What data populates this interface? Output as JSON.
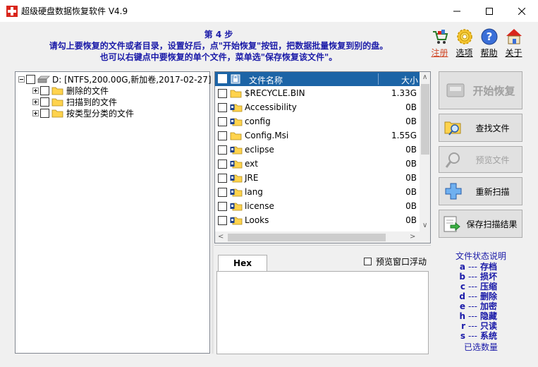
{
  "window": {
    "title": "超级硬盘数据恢复软件 V4.9"
  },
  "instructions": {
    "step": "第 4 步",
    "line1": "请勾上要恢复的文件或者目录，设置好后，点\"开始恢复\"按钮，把数据批量恢复到别的盘。",
    "line2": "也可以右键点中要恢复的单个文件，菜单选\"保存恢复该文件\"。"
  },
  "top_icons": [
    {
      "label": "注册",
      "icon": "cart-icon",
      "color": "#d04a2a"
    },
    {
      "label": "选项",
      "icon": "gear-icon",
      "color": "#000000"
    },
    {
      "label": "帮助",
      "icon": "help-icon",
      "color": "#000000"
    },
    {
      "label": "关于",
      "icon": "house-icon",
      "color": "#000000"
    }
  ],
  "tree": {
    "root": "D: [NTFS,200.00G,新加卷,2017-02-27]",
    "children": [
      "删除的文件",
      "扫描到的文件",
      "按类型分类的文件"
    ]
  },
  "file_list": {
    "headers": {
      "name": "文件名称",
      "size": "大小"
    },
    "rows": [
      {
        "name": "$RECYCLE.BIN",
        "size": "1.33G",
        "icon": "folder-icon"
      },
      {
        "name": "Accessibility",
        "size": "0B",
        "icon": "folder-lock-icon"
      },
      {
        "name": "config",
        "size": "0B",
        "icon": "folder-lock-icon"
      },
      {
        "name": "Config.Msi",
        "size": "1.55G",
        "icon": "folder-icon"
      },
      {
        "name": "eclipse",
        "size": "0B",
        "icon": "folder-lock-icon"
      },
      {
        "name": "ext",
        "size": "0B",
        "icon": "folder-lock-icon"
      },
      {
        "name": "JRE",
        "size": "0B",
        "icon": "folder-lock-icon"
      },
      {
        "name": "lang",
        "size": "0B",
        "icon": "folder-lock-icon"
      },
      {
        "name": "license",
        "size": "0B",
        "icon": "folder-lock-icon"
      },
      {
        "name": "Looks",
        "size": "0B",
        "icon": "folder-lock-icon"
      }
    ]
  },
  "hex": {
    "tab": "Hex",
    "float_option": "预览窗口浮动"
  },
  "buttons": {
    "start": "开始恢复",
    "find": "查找文件",
    "preview": "预览文件",
    "rescan": "重新扫描",
    "save_scan": "保存扫描结果"
  },
  "legend": {
    "title": "文件状态说明",
    "rows": [
      {
        "key": "a",
        "value": "存档"
      },
      {
        "key": "b",
        "value": "损坏"
      },
      {
        "key": "c",
        "value": "压缩"
      },
      {
        "key": "d",
        "value": "删除"
      },
      {
        "key": "e",
        "value": "加密"
      },
      {
        "key": "h",
        "value": "隐藏"
      },
      {
        "key": "r",
        "value": "只读"
      },
      {
        "key": "s",
        "value": "系统"
      }
    ],
    "dash": "---",
    "count_label": "已选数量"
  }
}
